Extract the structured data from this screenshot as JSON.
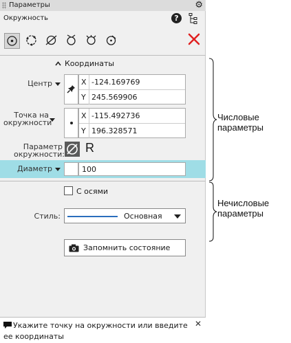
{
  "window": {
    "title": "Параметры"
  },
  "panel": {
    "subtitle": "Окружность"
  },
  "section": {
    "coords_title": "Координаты"
  },
  "center": {
    "label": "Центр",
    "x_key": "X",
    "x_value": "-124.169769",
    "y_key": "Y",
    "y_value": "245.569906"
  },
  "point": {
    "label_line1": "Точка на",
    "label_line2": "окружности",
    "x_key": "X",
    "x_value": "-115.492736",
    "y_key": "Y",
    "y_value": "196.328571"
  },
  "param": {
    "label_line1": "Параметр",
    "label_line2": "окружности:",
    "r_label": "R"
  },
  "diameter": {
    "label": "Диаметр",
    "value": "100"
  },
  "axes": {
    "label": "С осями"
  },
  "style": {
    "label": "Стиль:",
    "value": "Основная"
  },
  "save_button": {
    "label": "Запомнить состояние"
  },
  "status": {
    "message": "Укажите точку на окружности или введите ее координаты"
  },
  "annotations": {
    "numeric_line1": "Числовые",
    "numeric_line2": "параметры",
    "non_numeric_line1": "Нечисловые",
    "non_numeric_line2": "параметры"
  },
  "colors": {
    "highlight": "#9fdde6",
    "close": "#e02020",
    "style_line": "#2a6ebd"
  },
  "icons": [
    "gear-icon",
    "help-icon",
    "tree-icon",
    "circle-center-radius-icon",
    "circle-3points-icon",
    "circle-tangent-curve-icon",
    "circle-tangent-2curves-icon",
    "circle-tangent-3curves-icon",
    "circle-center-tangent-icon",
    "close-icon",
    "pin-icon",
    "dot-icon",
    "diameter-icon",
    "camera-icon",
    "message-icon"
  ]
}
